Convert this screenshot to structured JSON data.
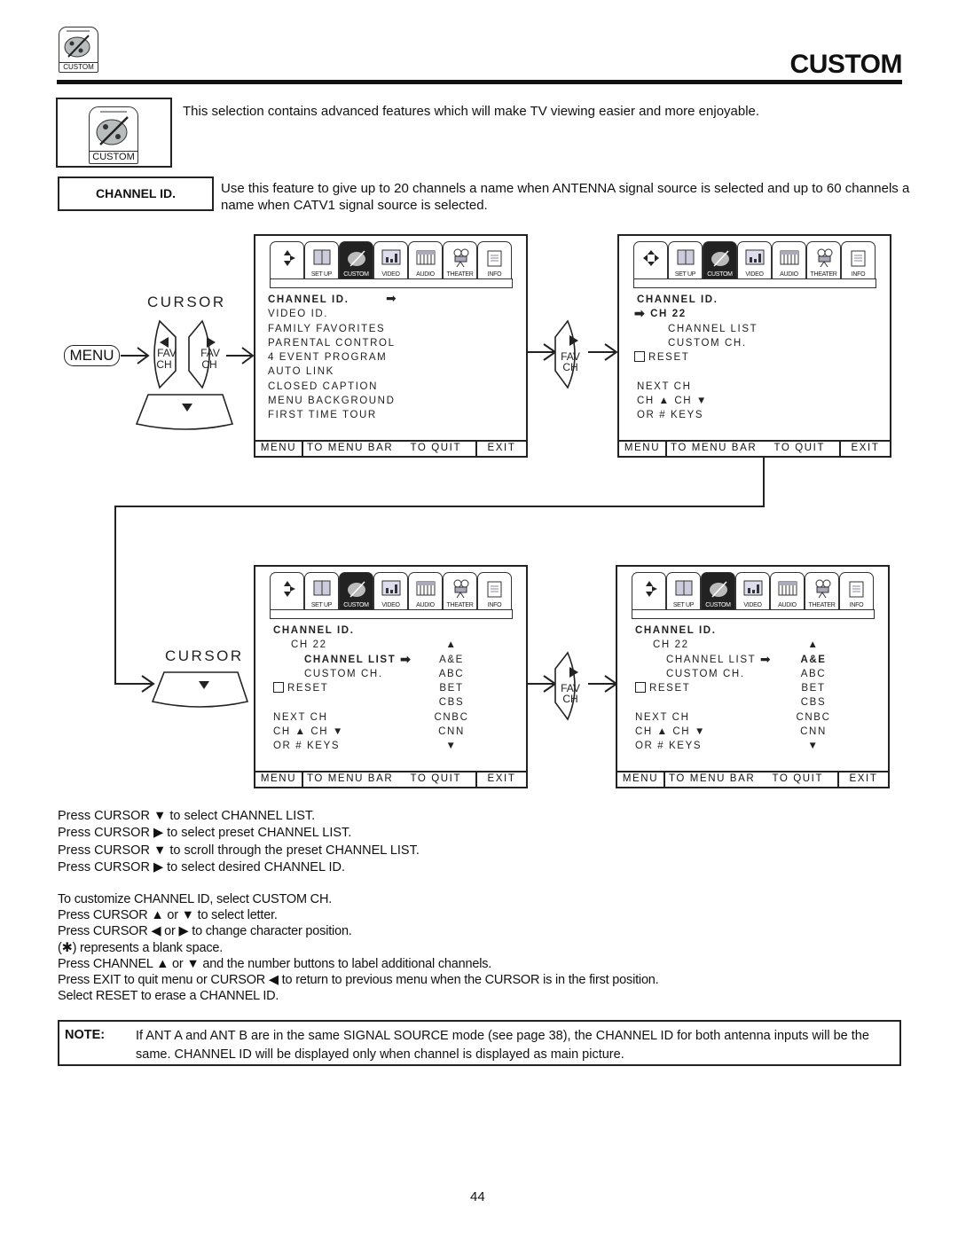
{
  "header": {
    "icon_label": "CUSTOM",
    "title": "CUSTOM"
  },
  "intro": {
    "icon_label": "CUSTOM",
    "text": "This selection contains advanced features which will make TV viewing easier and more enjoyable."
  },
  "feature": {
    "label": "CHANNEL ID.",
    "description": "Use this feature to give up to 20 channels a name when ANTENNA signal source is selected and up to 60 channels a name when CATV1 signal source is selected."
  },
  "remote": {
    "cursor_label": "CURSOR",
    "menu_label": "MENU",
    "fav": "FAV",
    "ch": "CH"
  },
  "tabs": [
    "",
    "SET UP",
    "CUSTOM",
    "VIDEO",
    "AUDIO",
    "THEATER",
    "INFO"
  ],
  "footer": {
    "menu": "MENU",
    "to_menu_bar": "TO MENU BAR",
    "to_quit": "TO QUIT",
    "exit": "EXIT"
  },
  "screen1": {
    "items": [
      "CHANNEL ID.",
      "VIDEO ID.",
      "FAMILY FAVORITES",
      "PARENTAL CONTROL",
      "4 EVENT PROGRAM",
      "AUTO LINK",
      "CLOSED CAPTION",
      "MENU BACKGROUND",
      "FIRST TIME TOUR"
    ]
  },
  "screen2": {
    "title": "CHANNEL ID.",
    "channel": "CH 22",
    "channel_list": "CHANNEL LIST",
    "custom_ch": "CUSTOM CH.",
    "reset": "RESET",
    "next_ch": "NEXT CH",
    "ch_updown": "CH ▲ CH ▼",
    "or_keys": "OR # KEYS"
  },
  "channel_list": [
    "A&E",
    "ABC",
    "BET",
    "CBS",
    "CNBC",
    "CNN"
  ],
  "steps": [
    "Press CURSOR  ▼ to select CHANNEL LIST.",
    "Press CURSOR ▶ to select preset CHANNEL LIST.",
    "Press CURSOR ▼ to scroll through the preset CHANNEL LIST.",
    "Press CURSOR ▶ to select desired CHANNEL ID."
  ],
  "steps2": [
    "To customize CHANNEL ID, select CUSTOM CH.",
    "Press CURSOR ▲ or ▼ to select letter.",
    "Press CURSOR ◀ or ▶ to change character position.",
    "(✱) represents a blank space.",
    "Press CHANNEL ▲ or ▼  and the number buttons to label additional channels.",
    "Press EXIT to quit menu or CURSOR ◀ to return to previous menu when the CURSOR is in the first position.",
    "Select RESET to erase a CHANNEL ID."
  ],
  "note": {
    "label": "NOTE:",
    "text": "If ANT A and ANT B are in the same SIGNAL SOURCE mode (see page 38), the CHANNEL ID for both antenna inputs will be the same.   CHANNEL ID will be displayed only when channel is displayed as main picture."
  },
  "page_number": "44"
}
